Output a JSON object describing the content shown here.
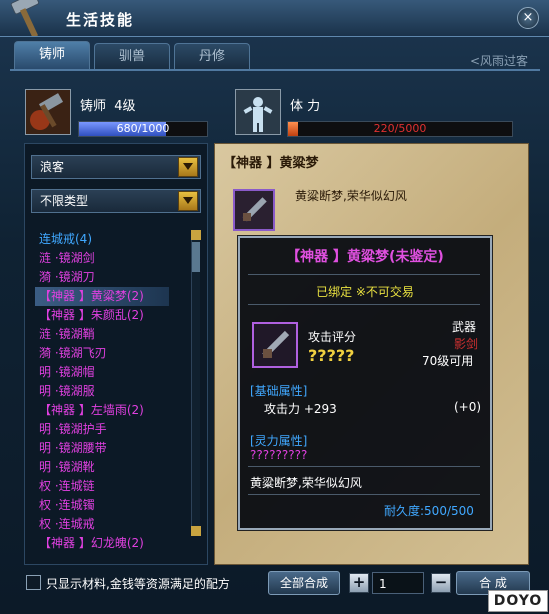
{
  "window": {
    "title": "生活技能",
    "close_label": "×"
  },
  "background_text": "<风雨过客",
  "tabs": [
    {
      "label": "铸师",
      "active": true
    },
    {
      "label": "驯兽",
      "active": false
    },
    {
      "label": "丹修",
      "active": false
    }
  ],
  "skills": {
    "smith": {
      "name": "铸师",
      "level": "4级",
      "progress_text": "680/1000",
      "progress": 0.68
    },
    "stamina": {
      "name": "体 力",
      "progress_text": "220/5000",
      "progress": 0.044
    }
  },
  "filters": {
    "category": "浪客",
    "type": "不限类型"
  },
  "recipe_list": [
    {
      "label": "连城戒(4)",
      "color": "#40a8ff"
    },
    {
      "label": "涟 ·镜湖剑",
      "color": "#e040e0"
    },
    {
      "label": "漪 ·镜湖刀",
      "color": "#e040e0"
    },
    {
      "label": "【神器 】黄粱梦(2)",
      "color": "#e040e0",
      "selected": true
    },
    {
      "label": "【神器 】朱颜乱(2)",
      "color": "#e040e0"
    },
    {
      "label": "涟 ·镜湖鞘",
      "color": "#e040e0"
    },
    {
      "label": "漪 ·镜湖飞刃",
      "color": "#e040e0"
    },
    {
      "label": "明 ·镜湖帽",
      "color": "#e040e0"
    },
    {
      "label": "明 ·镜湖服",
      "color": "#e040e0"
    },
    {
      "label": "【神器 】左墙雨(2)",
      "color": "#e040e0"
    },
    {
      "label": "明 ·镜湖护手",
      "color": "#e040e0"
    },
    {
      "label": "明 ·镜湖腰带",
      "color": "#e040e0"
    },
    {
      "label": "明 ·镜湖靴",
      "color": "#e040e0"
    },
    {
      "label": "权 ·连城链",
      "color": "#e040e0"
    },
    {
      "label": "权 ·连城镯",
      "color": "#e040e0"
    },
    {
      "label": "权 ·连城戒",
      "color": "#e040e0"
    },
    {
      "label": "【神器 】幻龙魄(2)",
      "color": "#e040e0"
    }
  ],
  "detail": {
    "title": "【神器 】黄粱梦",
    "description": "黄粱断梦,荣华似幻风"
  },
  "tooltip": {
    "title": "【神器 】黄粱梦(未鉴定)",
    "bound": "已绑定  ※不可交易",
    "score_label": "攻击评分",
    "score_value": "?????",
    "item_type": "武器",
    "subtype": "影剑",
    "level_req": "70级可用",
    "base_header": "[基础属性]",
    "attack_label": "攻击力  +293",
    "attack_bonus": "(+0)",
    "spirit_header": "[灵力属性]",
    "spirit_value": "?????????",
    "description": "黄粱断梦,荣华似幻风",
    "durability": "耐久度:500/500"
  },
  "footer": {
    "checkbox_label": "只显示材料,金钱等资源满足的配方",
    "craft_all_label": "全部合成",
    "plus_label": "+",
    "minus_label": "−",
    "quantity": "1",
    "craft_label": "合 成"
  },
  "logo": "DOYO",
  "colors": {
    "accent": "#5079a0",
    "rare": "#e040e0",
    "highlight": "#e8e040",
    "progress_blue": "#4f6fdf",
    "progress_red": "#d03020"
  }
}
